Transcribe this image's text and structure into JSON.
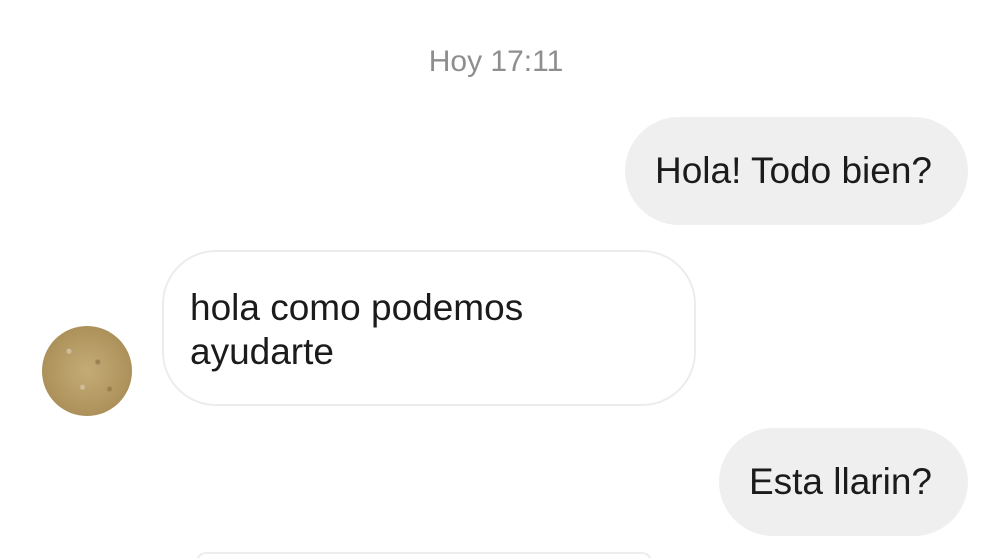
{
  "conversation": {
    "timestamp": "Hoy 17:11",
    "messages": [
      {
        "direction": "outgoing",
        "text": "Hola! Todo bien?"
      },
      {
        "direction": "incoming",
        "text": "hola como podemos ayudarte"
      },
      {
        "direction": "outgoing",
        "text": "Esta llarin?"
      }
    ]
  },
  "colors": {
    "outgoing_bubble": "#efefef",
    "incoming_bubble_border": "#ececec",
    "timestamp_text": "#8e8e8e",
    "message_text": "#1b1b1b"
  },
  "icons": {
    "contact_avatar": "avatar-icon"
  }
}
